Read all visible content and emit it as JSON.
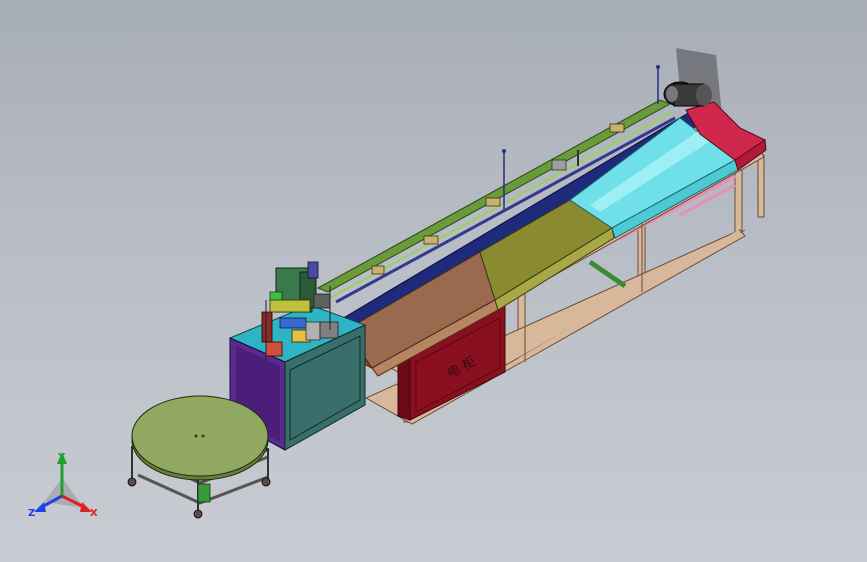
{
  "scene": {
    "cabinet_label": "电 柜",
    "colors": {
      "background_top": "#a7adb7",
      "background_bottom": "#c9ccd2",
      "frame": "#d8b89a",
      "frame_edge": "#6b4a38",
      "electric_cabinet": "#8a1020",
      "turntable_top": "#90a860",
      "control_box_front": "#3a6e6a",
      "control_box_side": "#5a2a8c",
      "control_box_top": "#2fb4c4",
      "trough_brown": "#9a6a4e",
      "trough_olive": "#8a8a30",
      "trough_cyan": "#6fe0e8",
      "trough_red": "#d0284a",
      "top_rail_green": "#6a9a3a",
      "inner_rail_blue": "#343a8a",
      "motor": "#2a2a2a"
    }
  },
  "triad": {
    "x_label": "X",
    "y_label": "Y",
    "z_label": "Z",
    "x_color": "#e02020",
    "y_color": "#20a030",
    "z_color": "#2040e0"
  }
}
